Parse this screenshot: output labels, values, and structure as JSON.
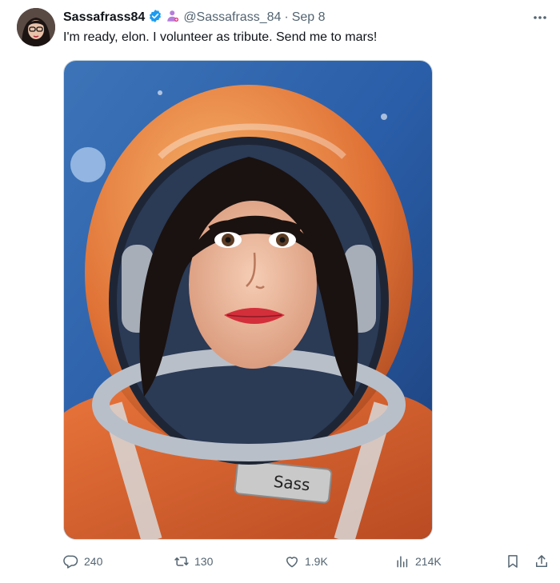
{
  "tweet": {
    "display_name": "Sassafrass84",
    "handle": "@Sassafrass_84",
    "separator": "·",
    "date": "Sep 8",
    "text": "I'm ready, elon. I volunteer as tribute. Send me to mars!",
    "media": {
      "badge_text": "Sass"
    }
  },
  "icons": {
    "verified": "verified-badge-icon",
    "affiliate": "affiliate-person-icon",
    "more": "more-options-icon",
    "reply": "reply-icon",
    "retweet": "retweet-icon",
    "like": "like-icon",
    "views": "views-icon",
    "bookmark": "bookmark-icon",
    "share": "share-icon"
  },
  "actions": {
    "replies": "240",
    "retweets": "130",
    "likes": "1.9K",
    "views": "214K"
  },
  "colors": {
    "text": "#0f1419",
    "secondary": "#536471",
    "verified": "#1d9bf0",
    "affiliate": "#b57edc"
  }
}
